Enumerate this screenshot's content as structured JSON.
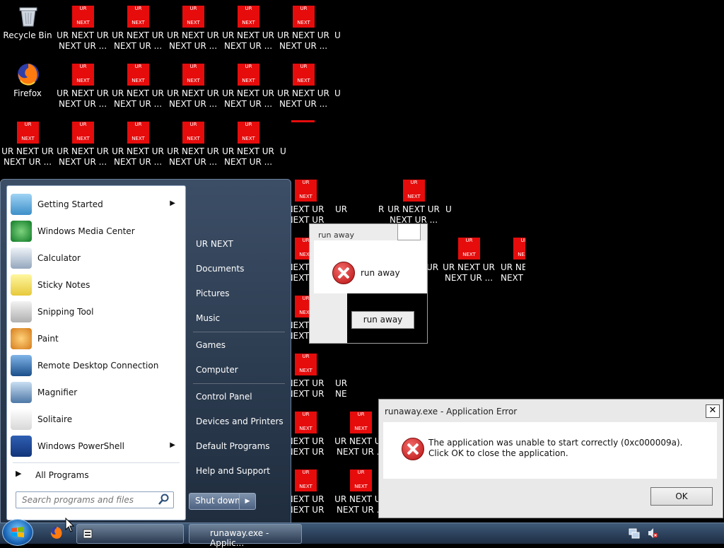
{
  "desktop": {
    "recycle_bin": "Recycle Bin",
    "firefox": "Firefox",
    "ur_icon_top": "UR",
    "ur_icon_bottom": "NEXT",
    "ur_label": "UR NEXT UR\nNEXT UR ...",
    "ur_label_partial_a": "NEXT UR\nNEXT UR",
    "ur_label_partial_b": "UR\nNE",
    "ur_label_partial_c": "UR NE\nNEXT",
    "ur_label_partial_d": "UR NEXT UR\nNEXT UR ...",
    "cut_char": "U",
    "ur_color": "#e60c0c"
  },
  "start_menu": {
    "programs": [
      {
        "label": "Getting Started",
        "has_arrow": true,
        "icon": "getting-started-icon"
      },
      {
        "label": "Windows Media Center",
        "has_arrow": false,
        "icon": "media-center-icon"
      },
      {
        "label": "Calculator",
        "has_arrow": false,
        "icon": "calculator-icon"
      },
      {
        "label": "Sticky Notes",
        "has_arrow": false,
        "icon": "sticky-notes-icon"
      },
      {
        "label": "Snipping Tool",
        "has_arrow": false,
        "icon": "snipping-tool-icon"
      },
      {
        "label": "Paint",
        "has_arrow": false,
        "icon": "paint-icon"
      },
      {
        "label": "Remote Desktop Connection",
        "has_arrow": false,
        "icon": "remote-desktop-icon"
      },
      {
        "label": "Magnifier",
        "has_arrow": false,
        "icon": "magnifier-icon"
      },
      {
        "label": "Solitaire",
        "has_arrow": false,
        "icon": "solitaire-icon"
      },
      {
        "label": "Windows PowerShell",
        "has_arrow": true,
        "icon": "powershell-icon"
      }
    ],
    "all_programs": "All Programs",
    "search_placeholder": "Search programs and files",
    "right_links": [
      "UR NEXT",
      "Documents",
      "Pictures",
      "Music",
      "Games",
      "Computer",
      "Control Panel",
      "Devices and Printers",
      "Default Programs",
      "Help and Support"
    ],
    "shutdown": "Shut down"
  },
  "run_away_dialog": {
    "title": "run away",
    "message": "run away",
    "button": "run away"
  },
  "error_dialog": {
    "title": "runaway.exe - Application Error",
    "message": "The application was unable to start correctly (0xc000009a). Click OK to close the application.",
    "ok": "OK",
    "close": "✕"
  },
  "taskbar": {
    "task_label": "runaway.exe - Applic..."
  }
}
